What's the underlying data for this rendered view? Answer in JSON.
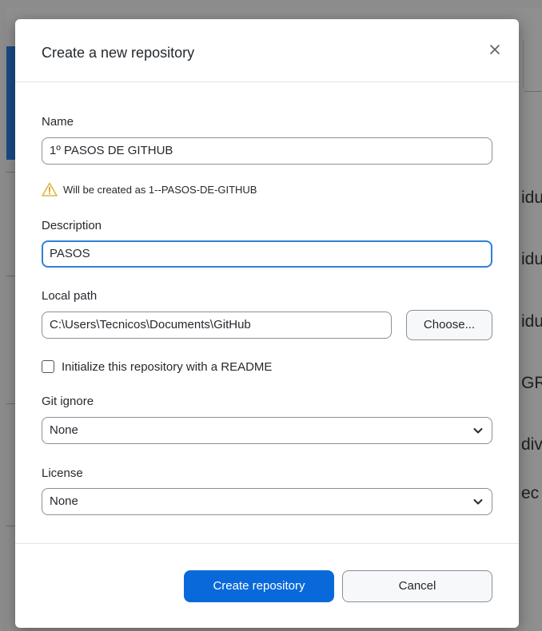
{
  "background": {
    "words": [
      "idu",
      "idu",
      "idu",
      "GRU",
      "div",
      "ec"
    ],
    "colors": {
      "accent": "#1a4a86",
      "overlay": "#8c8c8c"
    }
  },
  "dialog": {
    "title": "Create a new repository",
    "close_icon": "close-icon",
    "name": {
      "label": "Name",
      "value": "1º PASOS DE GITHUB",
      "warning_icon": "warning-icon",
      "warning": "Will be created as 1--PASOS-DE-GITHUB"
    },
    "description": {
      "label": "Description",
      "value": "PASOS"
    },
    "local_path": {
      "label": "Local path",
      "value": "C:\\Users\\Tecnicos\\Documents\\GitHub",
      "choose_label": "Choose..."
    },
    "readme": {
      "label": "Initialize this repository with a README",
      "checked": false
    },
    "gitignore": {
      "label": "Git ignore",
      "selected": "None"
    },
    "license": {
      "label": "License",
      "selected": "None"
    },
    "buttons": {
      "create": "Create repository",
      "cancel": "Cancel"
    },
    "colors": {
      "primary": "#0969da",
      "focus": "#2f7fd8",
      "warning": "#e3b341"
    }
  }
}
